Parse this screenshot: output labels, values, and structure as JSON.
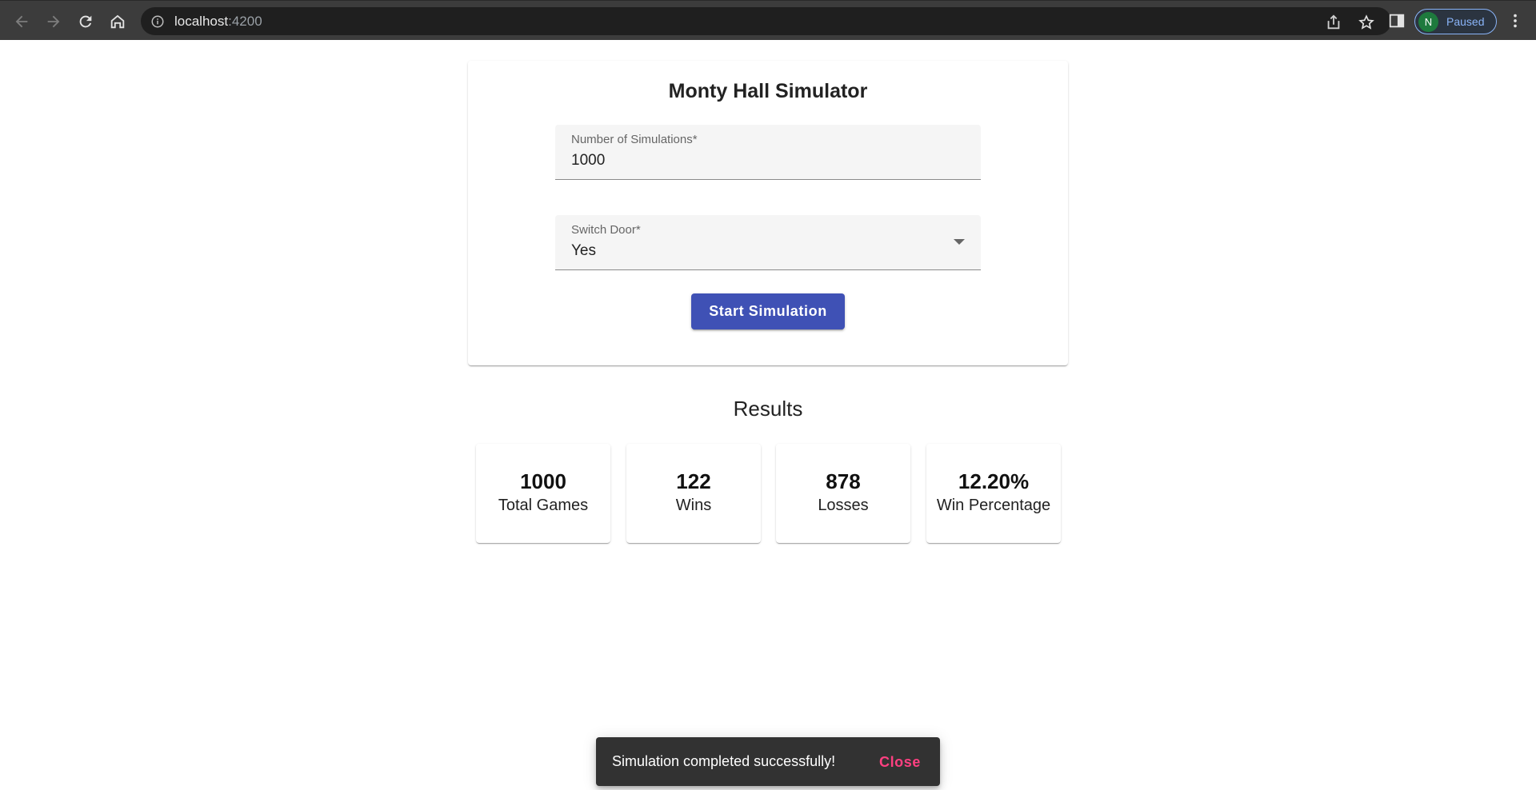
{
  "browser": {
    "url_host": "localhost",
    "url_port": ":4200",
    "profile_initial": "N",
    "profile_status": "Paused",
    "icons": [
      "back-arrow-icon",
      "forward-arrow-icon",
      "reload-icon",
      "home-icon",
      "info-icon",
      "share-icon",
      "star-icon",
      "side-panel-icon",
      "more-vert-icon"
    ],
    "colors": {
      "toolbar": "#3c3c3c",
      "omnibox": "#1f1f1f",
      "profile_accent": "#8ab4f8",
      "avatar": "#1e7a3d"
    }
  },
  "simulator": {
    "title": "Monty Hall Simulator",
    "simulations_label": "Number of Simulations*",
    "simulations_value": "1000",
    "switch_label": "Switch Door*",
    "switch_value": "Yes",
    "start_button": "Start Simulation",
    "colors": {
      "primary": "#3f51b5"
    }
  },
  "results": {
    "title": "Results",
    "stats": [
      {
        "value": "1000",
        "label": "Total Games"
      },
      {
        "value": "122",
        "label": "Wins"
      },
      {
        "value": "878",
        "label": "Losses"
      },
      {
        "value": "12.20%",
        "label": "Win Percentage"
      }
    ]
  },
  "snackbar": {
    "message": "Simulation completed successfully!",
    "action": "Close",
    "colors": {
      "background": "#323232",
      "action": "#ff4081"
    }
  }
}
